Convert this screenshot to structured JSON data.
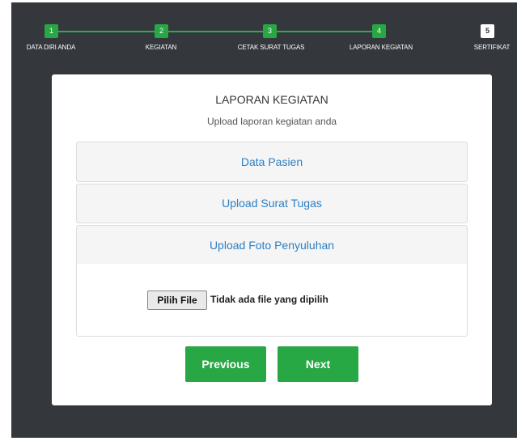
{
  "stepper": {
    "steps": [
      {
        "number": "1",
        "label": "DATA DIRI ANDA"
      },
      {
        "number": "2",
        "label": "KEGIATAN"
      },
      {
        "number": "3",
        "label": "CETAK SURAT TUGAS"
      },
      {
        "number": "4",
        "label": "LAPORAN KEGIATAN"
      },
      {
        "number": "5",
        "label": "SERTIFIKAT"
      }
    ]
  },
  "card": {
    "title": "LAPORAN KEGIATAN",
    "subtitle": "Upload laporan kegiatan anda",
    "panels": [
      "Data Pasien",
      "Upload Surat Tugas",
      "Upload Foto Penyuluhan"
    ],
    "file_input": {
      "button_label": "Pilih File",
      "status_text": "Tidak ada file yang dipilih"
    }
  },
  "nav": {
    "previous_label": "Previous",
    "next_label": "Next"
  },
  "colors": {
    "accent": "#28a745",
    "background": "#34373c",
    "link": "#2b7fc4"
  }
}
